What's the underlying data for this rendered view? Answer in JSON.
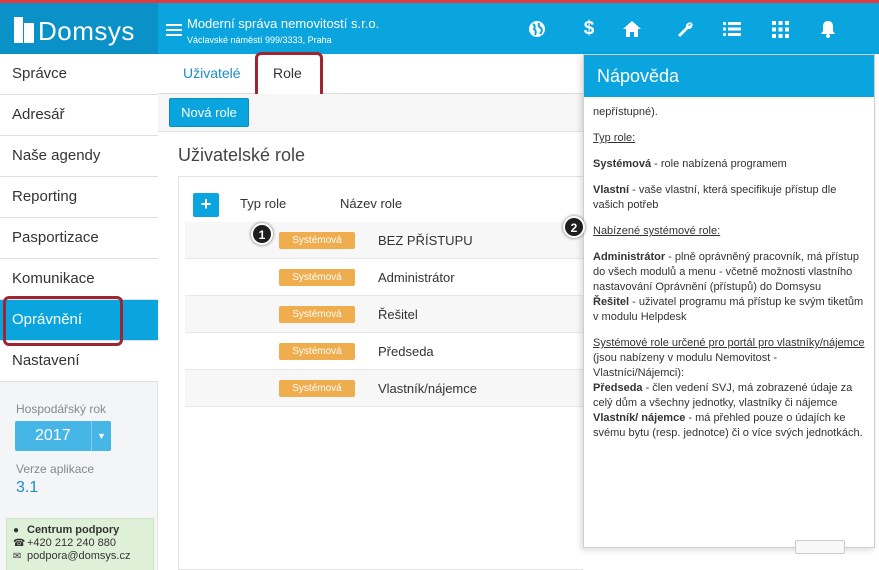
{
  "app": {
    "brand": "Domsys",
    "company_name": "Moderní správa nemovitostí s.r.o.",
    "company_address": "Václavské náměstí 999/3333, Praha",
    "accent_color": "#0aa5de",
    "top_icons": [
      "globe-icon",
      "dollar-icon",
      "home-icon",
      "wrench-icon",
      "list-icon",
      "grid-icon",
      "bell-icon"
    ]
  },
  "sidebar": {
    "items": [
      {
        "label": "Správce"
      },
      {
        "label": "Adresář"
      },
      {
        "label": "Naše agendy"
      },
      {
        "label": "Reporting"
      },
      {
        "label": "Pasportizace"
      },
      {
        "label": "Komunikace"
      },
      {
        "label": "Oprávnění",
        "active": true
      },
      {
        "label": "Nastavení"
      }
    ],
    "fiscal_year_label": "Hospodářský rok",
    "fiscal_year_value": "2017",
    "version_label": "Verze aplikace",
    "version_value": "3.1",
    "support": {
      "title": "Centrum podpory",
      "phone": "+420 212 240 880",
      "email": "podpora@domsys.cz"
    }
  },
  "main": {
    "tabs": [
      {
        "label": "Uživatelé"
      },
      {
        "label": "Role",
        "active": true
      }
    ],
    "new_role_button": "Nová role",
    "title": "Uživatelské role",
    "add_button": "+",
    "columns": {
      "type": "Typ role",
      "name": "Název role"
    },
    "rows": [
      {
        "type": "Systémová",
        "name": "BEZ PŘÍSTUPU"
      },
      {
        "type": "Systémová",
        "name": "Administrátor"
      },
      {
        "type": "Systémová",
        "name": "Řešitel"
      },
      {
        "type": "Systémová",
        "name": "Předseda"
      },
      {
        "type": "Systémová",
        "name": "Vlastník/nájemce"
      }
    ]
  },
  "callouts": [
    "1",
    "2"
  ],
  "help": {
    "title": "Nápověda",
    "intro": "nepřístupné).",
    "role_type_heading": "Typ role:",
    "system_term": "Systémová",
    "system_desc": " - role nabízená programem",
    "own_term": "Vlastní",
    "own_desc": " - vaše vlastní, která specifikuje přístup dle vašich potřeb",
    "offered_heading": "Nabízené systémové role:",
    "admin_term": "Administrátor",
    "admin_desc": " - plně oprávněný pracovník, má přístup do všech modulů a menu - včetně možnosti vlastního nastavování Oprávnění (přístupů) do Domsysu",
    "solver_term": "Řešitel",
    "solver_desc": " - uživatel programu má přístup ke svým tiketům v modulu Helpdesk",
    "portal_heading": "Systémové role určené pro portál pro vlastníky/nájemce",
    "portal_desc": " (jsou nabízeny v modulu Nemovitost - Vlastníci/Nájemci):",
    "chair_term": "Předseda",
    "chair_desc": " - člen vedení SVJ, má zobrazené údaje za celý dům a všechny jednotky, vlastníky či nájemce",
    "owner_term": "Vlastník/ nájemce",
    "owner_desc": " - má přehled pouze o údajích ke svému bytu (resp. jednotce) či o více svých jednotkách."
  }
}
